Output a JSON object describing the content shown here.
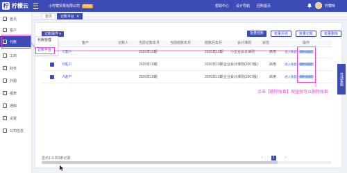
{
  "app": {
    "logo_char": "柠",
    "name": "柠檬云"
  },
  "header": {
    "company": "小柠檬贸易有限公司",
    "badge": "免费版",
    "links": [
      "帮助中心",
      "设计导航",
      "回购首页"
    ],
    "user": "柠檬味"
  },
  "sidebar": {
    "items": [
      {
        "label": "首页"
      },
      {
        "label": "客户"
      },
      {
        "label": "代账"
      },
      {
        "label": "工商"
      },
      {
        "label": "财务"
      },
      {
        "label": "外勤"
      },
      {
        "label": "报表"
      },
      {
        "label": "通知"
      },
      {
        "label": "设置"
      },
      {
        "label": "公司信息"
      }
    ]
  },
  "tabs": {
    "home": "首页",
    "current": "记账平台",
    "close_glyph": "✕"
  },
  "toolbar": {
    "dropdown": "记账操作 ▾",
    "menu_items": [
      "代账管理",
      "记账平台"
    ],
    "buttons": [
      "批量结账",
      "批量反结",
      "批量记账",
      "批量删除"
    ]
  },
  "table": {
    "headers": [
      "客户",
      "记账人",
      "当前记账年月",
      "当前结账年月",
      "结账后年月",
      "会计准则",
      "状态",
      "操作"
    ],
    "rows": [
      {
        "customer": "C客户",
        "booker": "",
        "current": "2020年10期",
        "closed": "",
        "after": "2020年10期",
        "standard": "小企业会计准则",
        "status": "启用",
        "ops": [
          "进入账套",
          "初始化账套",
          "删除账套"
        ]
      },
      {
        "customer": "B客户",
        "booker": "",
        "current": "2020年10期",
        "closed": "",
        "after": "2020年10期",
        "standard": "企业会计准则(2007版)",
        "status": "启用",
        "ops": [
          "进入账套",
          "初始化账套",
          "删除账套"
        ]
      },
      {
        "customer": "A客户",
        "booker": "",
        "current": "2020年10期",
        "closed": "",
        "after": "2020年10期",
        "standard": "企业会计准则(2007版)",
        "status": "启用",
        "ops": [
          "进入账套",
          "初始化账套",
          "删除账套"
        ]
      }
    ]
  },
  "annotation": "点击【删除账套】按钮就可以删除账套",
  "float_panel": "在线客服",
  "footer": {
    "summary": "显示1-3,共3条记录",
    "pages": [
      "‹",
      "1",
      "›"
    ]
  },
  "colors": {
    "brand": "#3d4bb5",
    "highlight": "#e84ad6",
    "link": "#3d6fd8"
  }
}
